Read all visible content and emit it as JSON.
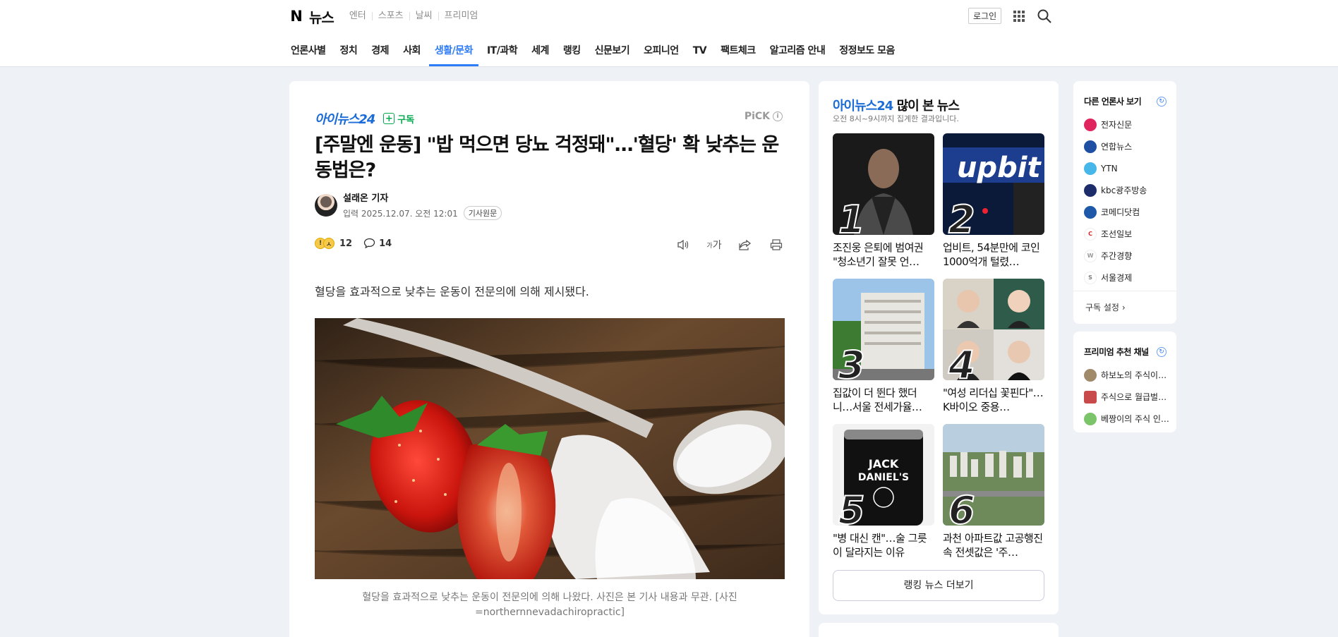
{
  "header": {
    "logo_text": "N",
    "news_label": "뉴스",
    "services": [
      "엔터",
      "스포츠",
      "날씨",
      "프리미엄"
    ],
    "login_label": "로그인",
    "menu": [
      {
        "label": "언론사별"
      },
      {
        "label": "정치"
      },
      {
        "label": "경제"
      },
      {
        "label": "사회"
      },
      {
        "label": "생활/문화"
      },
      {
        "label": "IT/과학"
      },
      {
        "label": "세계"
      },
      {
        "label": "랭킹"
      },
      {
        "label": "신문보기"
      },
      {
        "label": "오피니언"
      },
      {
        "label": "TV"
      },
      {
        "label": "팩트체크"
      },
      {
        "label": "알고리즘 안내"
      },
      {
        "label": "정정보도 모음"
      }
    ],
    "active_menu": "생활/문화"
  },
  "article": {
    "press_name": "아이뉴스24",
    "subscribe_label": "구독",
    "pick_label": "PiCK",
    "title": "[주말엔 운동] \"밥 먹으면 당뇨 걱정돼\"…'혈당' 확 낮추는 운동법은?",
    "reporter": "설래온 기자",
    "date": "입력 2025.12.07. 오전 12:01",
    "original_button": "기사원문",
    "reaction_count": "12",
    "comment_count": "14",
    "font_size_label": "가",
    "lead": "혈당을 효과적으로 낮추는 운동이 전문의에 의해 제시됐다.",
    "caption": "혈당을 효과적으로 낮추는 운동이 전문의에 의해 나왔다. 사진은 본 기사 내용과 무관. [사진=northernnevadachiropractic]"
  },
  "ranking": {
    "press_name": "아이뉴스24",
    "title_suffix": " 많이 본 뉴스",
    "subtitle": "오전 8시~9시까지 집계한 결과입니다.",
    "items": [
      {
        "rank": "1",
        "title": "조진웅 은퇴에 범여권 \"청소년기 잘못 언…"
      },
      {
        "rank": "2",
        "title": "업비트, 54분만에 코인 1000억개 털렸…"
      },
      {
        "rank": "3",
        "title": "집값이 더 뛴다 했더니…서울 전세가율…"
      },
      {
        "rank": "4",
        "title": "\"여성 리더십 꽃핀다\"…K바이오 중용…"
      },
      {
        "rank": "5",
        "title": "\"병 대신 캔\"…술 그릇이 달라지는 이유"
      },
      {
        "rank": "6",
        "title": "과천 아파트값 고공행진 속 전셋값은 '주…"
      }
    ],
    "more_label": "랭킹 뉴스 더보기"
  },
  "other_press": {
    "title": "다른 언론사 보기",
    "items": [
      {
        "name": "전자신문",
        "color": "#e0245e"
      },
      {
        "name": "연합뉴스",
        "color": "#1f4fa3"
      },
      {
        "name": "YTN",
        "color": "#47b6e8"
      },
      {
        "name": "kbc광주방송",
        "color": "#1d2c6b"
      },
      {
        "name": "코메디닷컴",
        "color": "#1d59a8"
      },
      {
        "name": "조선일보",
        "color": "#d9262c"
      },
      {
        "name": "주간경향",
        "color": "#9a9a9a"
      },
      {
        "name": "서울경제",
        "color": "#7d7d7d"
      }
    ],
    "setting_label": "구독 설정"
  },
  "premium": {
    "title": "프리미엄 추천 채널",
    "items": [
      {
        "name": "하보노의 주식이…"
      },
      {
        "name": "주식으로 월급벌…"
      },
      {
        "name": "베짱이의 주식 인…"
      }
    ]
  }
}
